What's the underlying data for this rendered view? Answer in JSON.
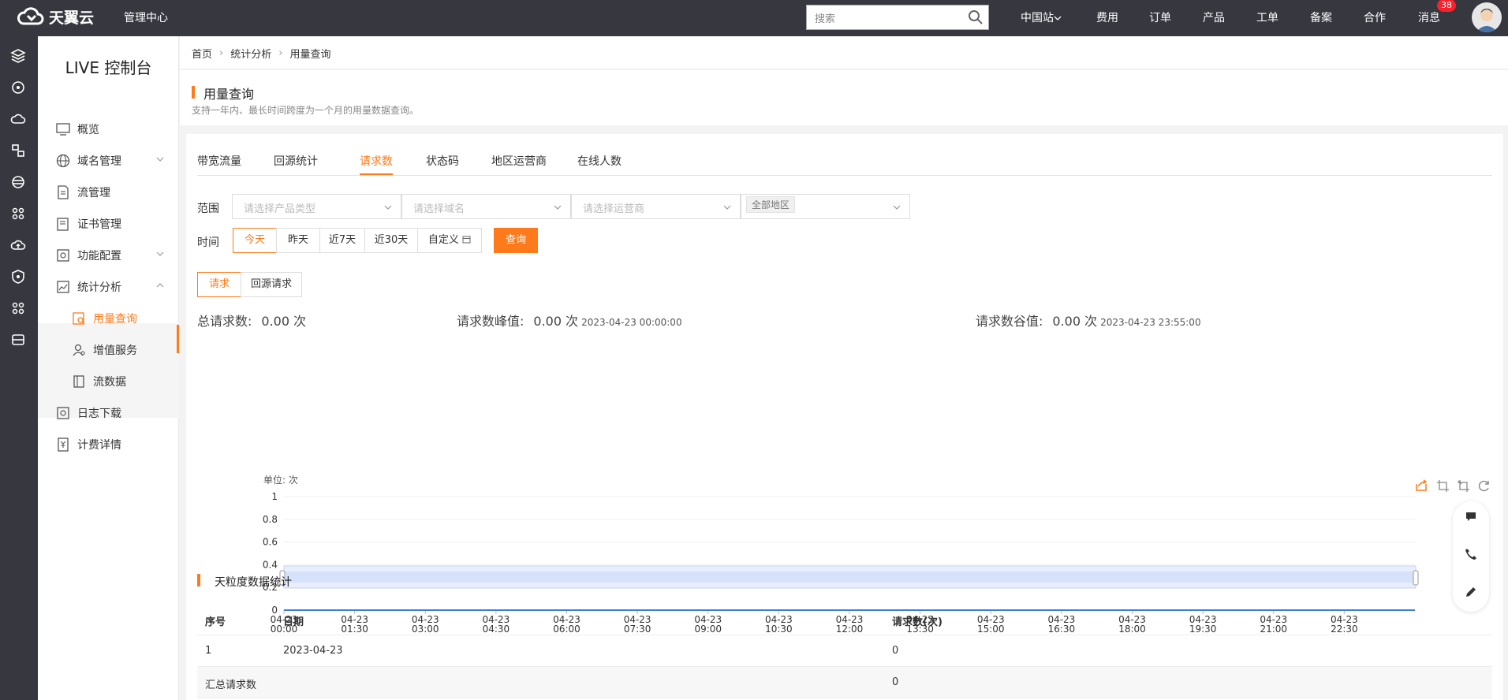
{
  "topbar": {
    "brand": "天翼云",
    "management": "管理中心",
    "search_placeholder": "搜索",
    "nav": [
      "中国站",
      "费用",
      "订单",
      "产品",
      "工单",
      "备案",
      "合作",
      "消息"
    ],
    "message_badge": "38"
  },
  "sidebar": {
    "title": "LIVE 控制台",
    "items": [
      {
        "label": "概览",
        "icon": "monitor-icon"
      },
      {
        "label": "域名管理",
        "icon": "globe-icon"
      },
      {
        "label": "流管理",
        "icon": "document-icon"
      },
      {
        "label": "证书管理",
        "icon": "certificate-icon"
      },
      {
        "label": "功能配置",
        "icon": "settings-icon"
      },
      {
        "label": "统计分析",
        "icon": "chart-icon"
      },
      {
        "label": "用量查询",
        "icon": "usage-icon"
      },
      {
        "label": "增值服务",
        "icon": "user-icon"
      },
      {
        "label": "流数据",
        "icon": "list-icon"
      },
      {
        "label": "日志下载",
        "icon": "log-icon"
      },
      {
        "label": "计费详情",
        "icon": "billing-icon"
      }
    ]
  },
  "breadcrumb": [
    "首页",
    "统计分析",
    "用量查询"
  ],
  "header": {
    "title": "用量查询",
    "description": "支持一年内、最长时间跨度为一个月的用量数据查询。"
  },
  "tabs": [
    "带宽流量",
    "回源统计",
    "请求数",
    "状态码",
    "地区运营商",
    "在线人数"
  ],
  "filters": {
    "range_label": "范围",
    "product_placeholder": "请选择产品类型",
    "domain_placeholder": "请选择域名",
    "operator_placeholder": "请选择运营商",
    "region_tag": "全部地区",
    "time_label": "时间",
    "time_buttons": [
      "今天",
      "昨天",
      "近7天",
      "近30天",
      "自定义"
    ],
    "query_button": "查询"
  },
  "request_types": [
    "请求",
    "回源请求"
  ],
  "stats": {
    "total_label": "总请求数:",
    "total_value": "0.00 次",
    "peak_label": "请求数峰值:",
    "peak_value": "0.00 次",
    "peak_time": "2023-04-23 00:00:00",
    "valley_label": "请求数谷值:",
    "valley_value": "0.00 次",
    "valley_time": "2023-04-23 23:55:00"
  },
  "chart_data": {
    "type": "line",
    "unit_label": "单位: 次",
    "x_ticks": [
      {
        "date": "04-23",
        "time": "00:00"
      },
      {
        "date": "04-23",
        "time": "01:30"
      },
      {
        "date": "04-23",
        "time": "03:00"
      },
      {
        "date": "04-23",
        "time": "04:30"
      },
      {
        "date": "04-23",
        "time": "06:00"
      },
      {
        "date": "04-23",
        "time": "07:30"
      },
      {
        "date": "04-23",
        "time": "09:00"
      },
      {
        "date": "04-23",
        "time": "10:30"
      },
      {
        "date": "04-23",
        "time": "12:00"
      },
      {
        "date": "04-23",
        "time": "13:30"
      },
      {
        "date": "04-23",
        "time": "15:00"
      },
      {
        "date": "04-23",
        "time": "16:30"
      },
      {
        "date": "04-23",
        "time": "18:00"
      },
      {
        "date": "04-23",
        "time": "19:30"
      },
      {
        "date": "04-23",
        "time": "21:00"
      },
      {
        "date": "04-23",
        "time": "22:30"
      }
    ],
    "y_ticks": [
      "0",
      "0.2",
      "0.4",
      "0.6",
      "0.8",
      "1"
    ],
    "ylim": [
      0,
      1
    ],
    "series": [
      {
        "values": [
          0,
          0,
          0,
          0,
          0,
          0,
          0,
          0,
          0,
          0,
          0,
          0,
          0,
          0,
          0,
          0,
          0
        ]
      }
    ],
    "line_color": "#3b7ddd",
    "grid": true
  },
  "daily": {
    "title": "天粒度数据统计",
    "columns": [
      "序号",
      "日期",
      "请求数(次)"
    ],
    "rows": [
      [
        "1",
        "2023-04-23",
        "0"
      ]
    ],
    "summary": [
      "汇总请求数",
      "0"
    ]
  },
  "colors": {
    "accent": "#ff7a1a",
    "dark": "#36373f"
  }
}
